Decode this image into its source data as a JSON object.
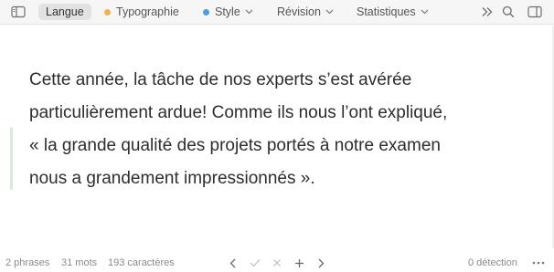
{
  "toolbar": {
    "tabs": [
      {
        "label": "Langue",
        "active": true
      },
      {
        "label": "Typographie",
        "dot_color": "#f0b24a"
      },
      {
        "label": "Style",
        "dot_color": "#4a9ee3"
      },
      {
        "label": "Révision"
      },
      {
        "label": "Statistiques"
      }
    ],
    "icons": [
      "sidebar-toggle-icon",
      "expand-icon",
      "search-icon",
      "right-panel-icon"
    ]
  },
  "document": {
    "lines": [
      "Cette année, la tâche de nos experts s’est avérée",
      "particulièrement ardue! Comme ils nous l’ont expliqué,",
      "« la grande qualité des projets portés à notre examen",
      "nous a grandement impressionnés »."
    ],
    "quote_color": "#d7ecdc"
  },
  "status": {
    "phrases": "2 phrases",
    "mots": "31 mots",
    "caracteres": "193 caractères",
    "detection": "0 détection"
  }
}
